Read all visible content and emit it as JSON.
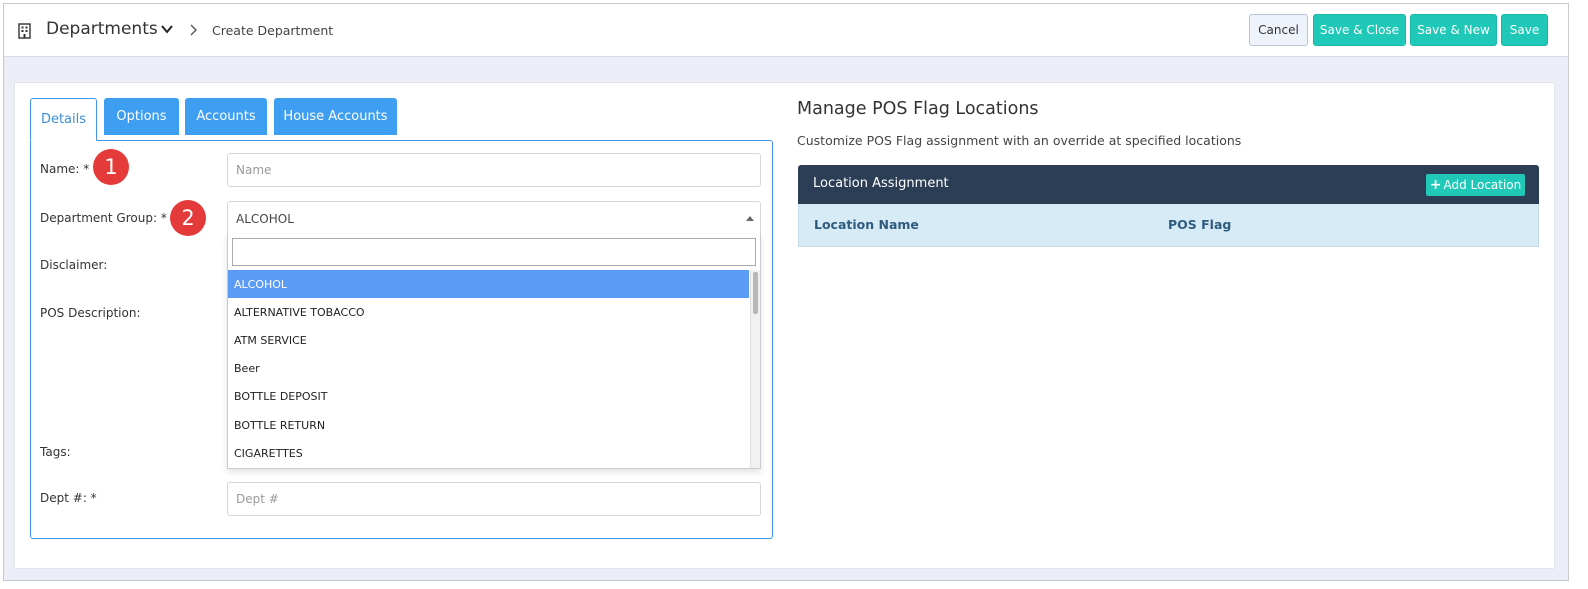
{
  "header": {
    "title": "Departments",
    "breadcrumb": "Create Department",
    "buttons": {
      "cancel": "Cancel",
      "save_close": "Save & Close",
      "save_new": "Save & New",
      "save": "Save"
    }
  },
  "tabs": {
    "details": "Details",
    "options": "Options",
    "accounts": "Accounts",
    "house_accounts": "House Accounts"
  },
  "form": {
    "name_label": "Name: *",
    "name_placeholder": "Name",
    "group_label": "Department Group: *",
    "group_value": "ALCOHOL",
    "disclaimer_label": "Disclaimer:",
    "pos_desc_label": "POS Description:",
    "tags_label": "Tags:",
    "dept_label": "Dept #: *",
    "dept_placeholder": "Dept #"
  },
  "badges": {
    "one": "1",
    "two": "2"
  },
  "dropdown": {
    "search_value": "",
    "options": [
      "ALCOHOL",
      "ALTERNATIVE TOBACCO",
      "ATM SERVICE",
      "Beer",
      "BOTTLE DEPOSIT",
      "BOTTLE RETURN",
      "CIGARETTES"
    ],
    "selected_index": 0
  },
  "pos_flags": {
    "title": "Manage POS Flag Locations",
    "subtitle": "Customize POS Flag assignment with an override at specified locations",
    "table_header": "Location Assignment",
    "add_button": "Add Location",
    "columns": [
      "Location Name",
      "POS Flag"
    ]
  },
  "colors": {
    "accent_teal": "#1fc8b7",
    "tab_blue": "#3d9ef2",
    "header_dark": "#2c3e55",
    "badge_red": "#e53a3a",
    "selected_option": "#5a9bf6"
  }
}
